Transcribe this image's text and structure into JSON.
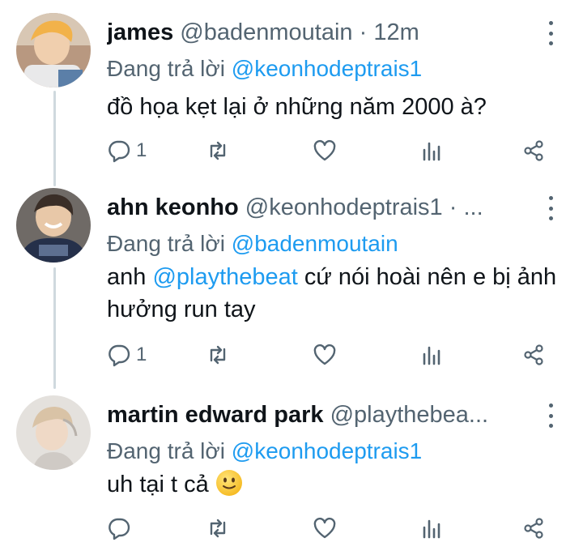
{
  "thread": [
    {
      "name": "james",
      "handle": "@badenmoutain",
      "meta": " · 12m",
      "reply_prefix": "Đang trả lời ",
      "reply_to": "@keonhodeptrais1",
      "body_text": "đồ họa kẹt lại ở những năm 2000 à?",
      "replies": "1",
      "avatar_bg": "#c9a58a"
    },
    {
      "name": "ahn keonho",
      "handle": "@keonhodeptrais1",
      "meta": " · ...",
      "reply_prefix": "Đang trả lời ",
      "reply_to": "@badenmoutain",
      "body_pre": "anh ",
      "body_mention": "@playthebeat",
      "body_post": " cứ nói hoài nên e bị ảnh hưởng run tay",
      "replies": "1",
      "avatar_bg": "#2b3447"
    },
    {
      "name": "martin edward park",
      "handle": "@playthebea...",
      "meta": "",
      "reply_prefix": "Đang trả lời ",
      "reply_to": "@keonhodeptrais1",
      "body_text": "uh tại t cả",
      "emoji": "slightly-smiling-face",
      "replies": "",
      "avatar_bg": "#e9e6e2"
    }
  ],
  "colors": {
    "text": "#0f1419",
    "secondary": "#536471",
    "link": "#1d9bf0",
    "thread_line": "#cfd9de"
  },
  "icons": [
    "reply-icon",
    "retweet-icon",
    "like-icon",
    "views-icon",
    "share-icon",
    "more-icon"
  ]
}
